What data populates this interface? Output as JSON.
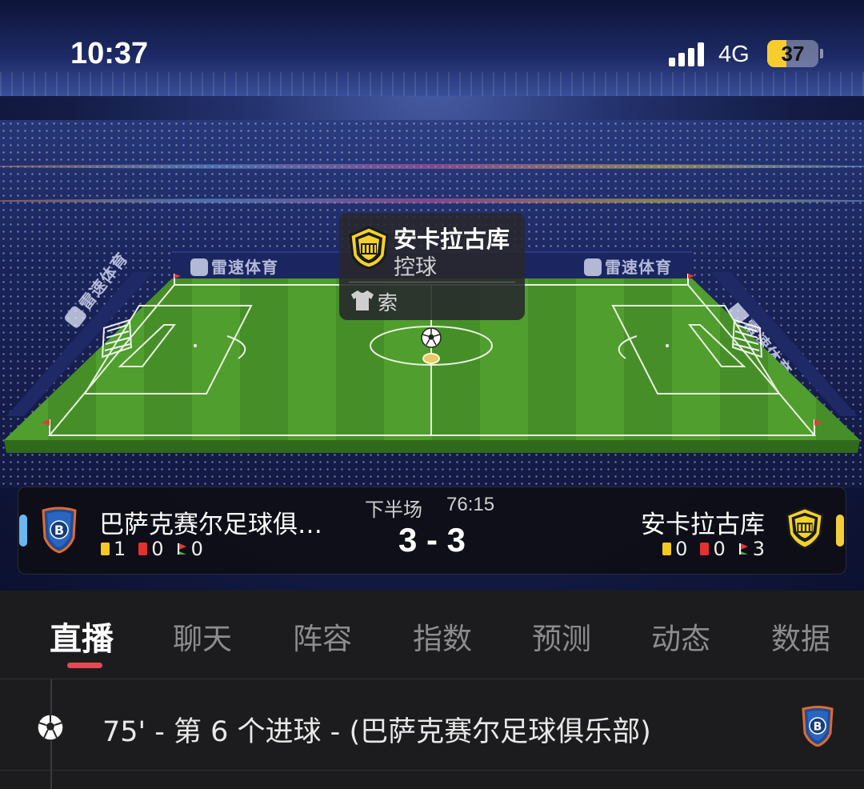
{
  "status_bar": {
    "time": "10:37",
    "network": "4G",
    "battery": "37",
    "battery_level": 0.37,
    "signal_bars": 4
  },
  "stadium": {
    "brand_text": "雷速体育"
  },
  "possession_popup": {
    "team": "安卡拉古库",
    "state": "控球",
    "player": "索"
  },
  "match": {
    "period": "下半场",
    "clock": "76:15",
    "score": "3 - 3",
    "home": {
      "name": "巴萨克赛尔足球俱乐部",
      "yellow_cards": "1",
      "red_cards": "0",
      "corners": "0",
      "color": "#6ab7f2"
    },
    "away": {
      "name": "安卡拉古库",
      "yellow_cards": "0",
      "red_cards": "0",
      "corners": "3",
      "color": "#f5cd3b"
    }
  },
  "tabs": [
    {
      "label": "直播",
      "active": true
    },
    {
      "label": "聊天",
      "active": false
    },
    {
      "label": "阵容",
      "active": false
    },
    {
      "label": "指数",
      "active": false
    },
    {
      "label": "预测",
      "active": false
    },
    {
      "label": "动态",
      "active": false
    },
    {
      "label": "数据",
      "active": false
    }
  ],
  "events": [
    {
      "icon": "soccer-ball-icon",
      "text": "75' - 第 6 个进球 - (巴萨克赛尔足球俱乐部)",
      "team_badge": "basaksehir-badge-icon"
    }
  ],
  "colors": {
    "accent": "#e24a55",
    "yellow_card": "#f5c823",
    "red_card": "#e43030",
    "pitch": "#4f9e2e"
  }
}
